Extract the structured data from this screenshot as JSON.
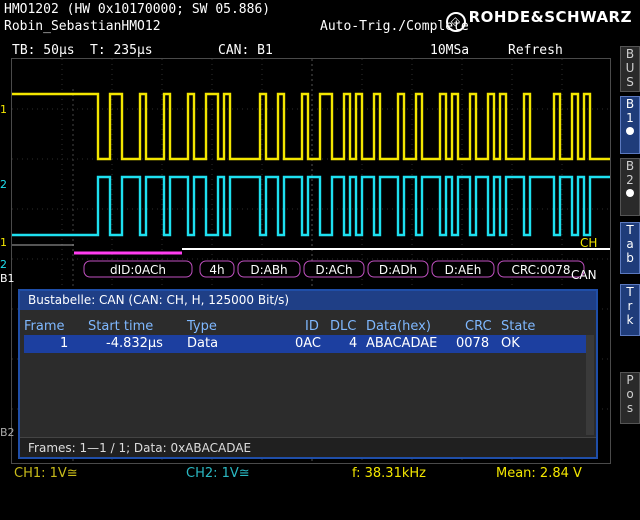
{
  "header": {
    "model": "HMO1202 (HW 0x10170000; SW 05.886)",
    "user": "Robin_SebastianHMO12",
    "trigger_status": "Auto-Trig./Complete",
    "brand": "ROHDE&SCHWARZ"
  },
  "status": {
    "timebase": "TB: 50µs",
    "trigger_time": "T: 235µs",
    "bus": "CAN: B1",
    "sample_rate": "10MSa",
    "mode": "Refresh"
  },
  "side_tabs": [
    {
      "label": "BUS"
    },
    {
      "label": "B1"
    },
    {
      "label": "B2"
    },
    {
      "label": "Tab"
    },
    {
      "label": "Trk"
    },
    {
      "label": "Pos"
    }
  ],
  "channel_markers": {
    "ch1": "1",
    "ch2": "2",
    "ch1_low": "1",
    "ch2_low": "2",
    "b1": "B1",
    "b2": "B2",
    "ch_label": "CH",
    "can_label": "CAN"
  },
  "decode": {
    "segments": [
      "dID:0ACh",
      "4h",
      "D:ABh",
      "D:ACh",
      "D:ADh",
      "D:AEh",
      "CRC:0078"
    ]
  },
  "bus_table": {
    "title": "Bustabelle: CAN (CAN: CH, H, 125000 Bit/s)",
    "columns": [
      "Frame",
      "Start time",
      "Type",
      "ID",
      "DLC",
      "Data(hex)",
      "CRC",
      "State"
    ],
    "rows": [
      {
        "frame": "1",
        "start_time": "-4.832µs",
        "type": "Data",
        "id": "0AC",
        "dlc": "4",
        "data": "ABACADAE",
        "crc": "0078",
        "state": "OK"
      }
    ],
    "footer": "Frames: 1—1 / 1; Data: 0xABACADAE"
  },
  "bottom": {
    "ch1": "CH1: 1V≅",
    "ch2": "CH2: 1V≅",
    "freq": "f: 38.31kHz",
    "mean": "Mean: 2.84 V"
  },
  "colors": {
    "ch1": "#f3e600",
    "ch2": "#1ee0f0",
    "bus1": "#ff3df0",
    "accent": "#1f4ea8"
  }
}
